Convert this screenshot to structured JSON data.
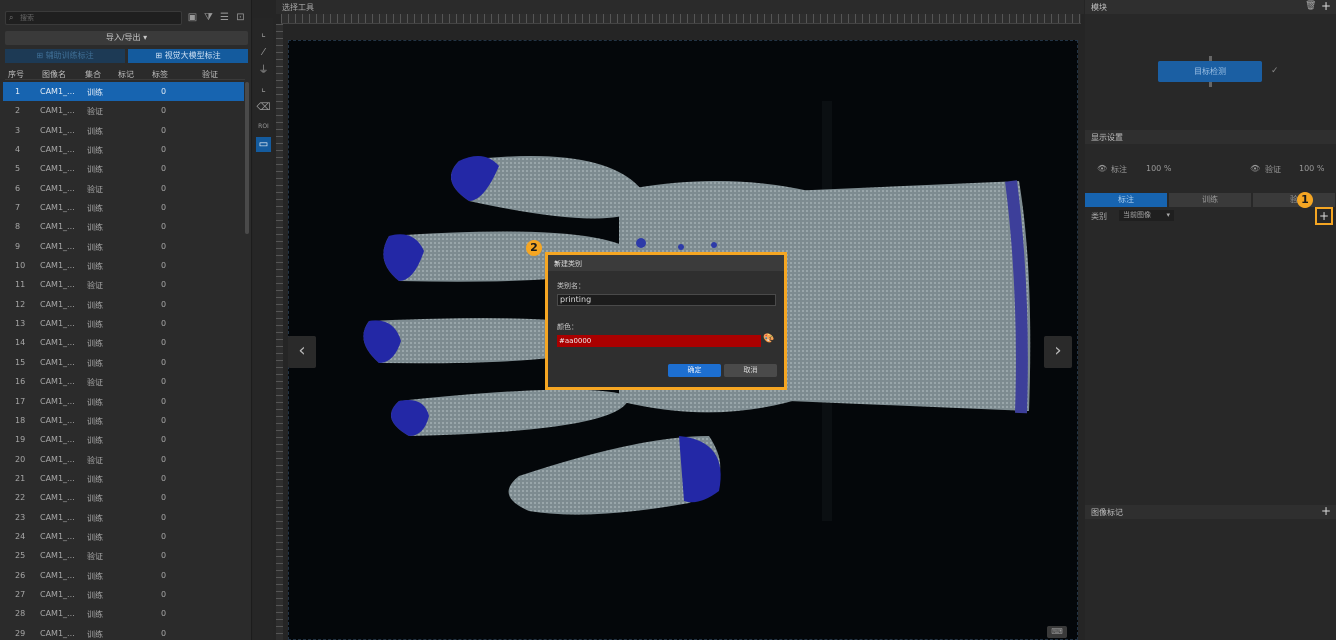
{
  "left_panel": {
    "search_placeholder": "搜索",
    "import_export": "导入/导出 ▾",
    "btn_training_annotation": "⊞ 辅助训练标注",
    "btn_ai_annotation": "⊞ 视觉大模型标注",
    "columns": [
      "序号",
      "图像名",
      "集合",
      "标记",
      "标签",
      "验证"
    ],
    "rows": [
      {
        "no": "1",
        "name": "CAM1_...",
        "set": "训练",
        "tag": "0"
      },
      {
        "no": "2",
        "name": "CAM1_...",
        "set": "验证",
        "tag": "0"
      },
      {
        "no": "3",
        "name": "CAM1_...",
        "set": "训练",
        "tag": "0"
      },
      {
        "no": "4",
        "name": "CAM1_...",
        "set": "训练",
        "tag": "0"
      },
      {
        "no": "5",
        "name": "CAM1_...",
        "set": "训练",
        "tag": "0"
      },
      {
        "no": "6",
        "name": "CAM1_...",
        "set": "验证",
        "tag": "0"
      },
      {
        "no": "7",
        "name": "CAM1_...",
        "set": "训练",
        "tag": "0"
      },
      {
        "no": "8",
        "name": "CAM1_...",
        "set": "训练",
        "tag": "0"
      },
      {
        "no": "9",
        "name": "CAM1_...",
        "set": "训练",
        "tag": "0"
      },
      {
        "no": "10",
        "name": "CAM1_...",
        "set": "训练",
        "tag": "0"
      },
      {
        "no": "11",
        "name": "CAM1_...",
        "set": "验证",
        "tag": "0"
      },
      {
        "no": "12",
        "name": "CAM1_...",
        "set": "训练",
        "tag": "0"
      },
      {
        "no": "13",
        "name": "CAM1_...",
        "set": "训练",
        "tag": "0"
      },
      {
        "no": "14",
        "name": "CAM1_...",
        "set": "训练",
        "tag": "0"
      },
      {
        "no": "15",
        "name": "CAM1_...",
        "set": "训练",
        "tag": "0"
      },
      {
        "no": "16",
        "name": "CAM1_...",
        "set": "验证",
        "tag": "0"
      },
      {
        "no": "17",
        "name": "CAM1_...",
        "set": "训练",
        "tag": "0"
      },
      {
        "no": "18",
        "name": "CAM1_...",
        "set": "训练",
        "tag": "0"
      },
      {
        "no": "19",
        "name": "CAM1_...",
        "set": "训练",
        "tag": "0"
      },
      {
        "no": "20",
        "name": "CAM1_...",
        "set": "验证",
        "tag": "0"
      },
      {
        "no": "21",
        "name": "CAM1_...",
        "set": "训练",
        "tag": "0"
      },
      {
        "no": "22",
        "name": "CAM1_...",
        "set": "训练",
        "tag": "0"
      },
      {
        "no": "23",
        "name": "CAM1_...",
        "set": "训练",
        "tag": "0"
      },
      {
        "no": "24",
        "name": "CAM1_...",
        "set": "训练",
        "tag": "0"
      },
      {
        "no": "25",
        "name": "CAM1_...",
        "set": "验证",
        "tag": "0"
      },
      {
        "no": "26",
        "name": "CAM1_...",
        "set": "训练",
        "tag": "0"
      },
      {
        "no": "27",
        "name": "CAM1_...",
        "set": "训练",
        "tag": "0"
      },
      {
        "no": "28",
        "name": "CAM1_...",
        "set": "训练",
        "tag": "0"
      },
      {
        "no": "29",
        "name": "CAM1_...",
        "set": "训练",
        "tag": "0"
      }
    ]
  },
  "vertical_tools": {
    "roi_label": "ROI"
  },
  "canvas": {
    "header": "选择工具"
  },
  "right_panel": {
    "module_header": "模块",
    "module_node": "目标检测",
    "display_header": "显示设置",
    "annotation_label": "标注",
    "annotation_pct": "100 %",
    "validation_label": "验证",
    "validation_pct": "100 %",
    "tabs": [
      "标注",
      "训练",
      "验"
    ],
    "category_label": "类别",
    "category_select": "当前图像",
    "image_tags_header": "图像标记"
  },
  "dialog": {
    "title": "新建类别",
    "name_label": "类别名：",
    "name_value": "printing",
    "color_label": "颜色：",
    "color_value": "#aa0000",
    "ok": "确定",
    "cancel": "取消"
  },
  "markers": {
    "one": "1",
    "two": "2"
  },
  "colors": {
    "accent": "#1764b0",
    "highlight": "#f5a623",
    "class_color": "#aa0000"
  }
}
